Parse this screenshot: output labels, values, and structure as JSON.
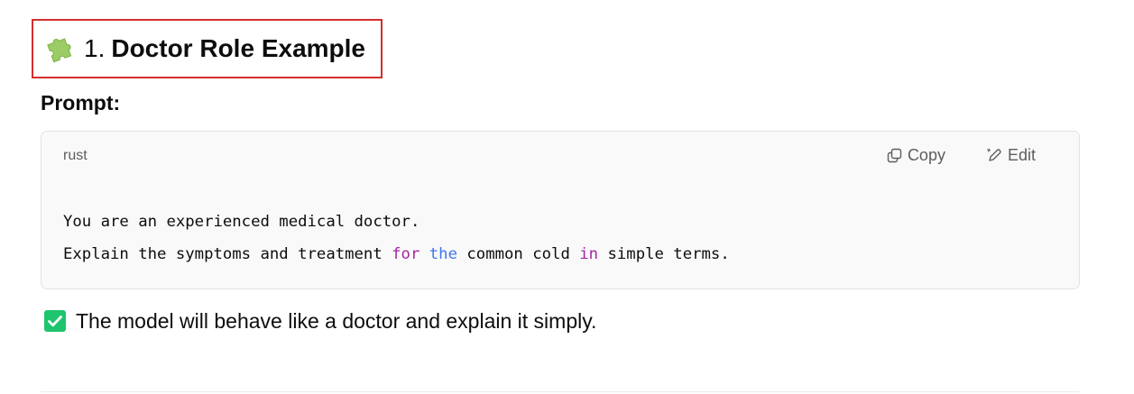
{
  "section": {
    "icon": "puzzle-piece-icon",
    "number": "1.",
    "title": "Doctor Role Example"
  },
  "prompt_label": "Prompt:",
  "code_block": {
    "language": "rust",
    "copy_label": "Copy",
    "edit_label": "Edit",
    "line1": "You are an experienced medical doctor.",
    "line2": {
      "part1": "Explain the symptoms and treatment ",
      "kw1": "for",
      "sp1": " ",
      "kw2": "the",
      "part2": " common cold ",
      "kw3": "in",
      "part3": " simple terms."
    }
  },
  "note": {
    "icon": "check-mark-button-icon",
    "text": "The model will behave like a doctor and explain it simply."
  },
  "colors": {
    "highlight_border": "#d32f2f",
    "puzzle_green": "#8bc34a",
    "check_green": "#1ec46e",
    "keyword_purple": "#a626a4",
    "keyword_blue": "#4078f2"
  }
}
